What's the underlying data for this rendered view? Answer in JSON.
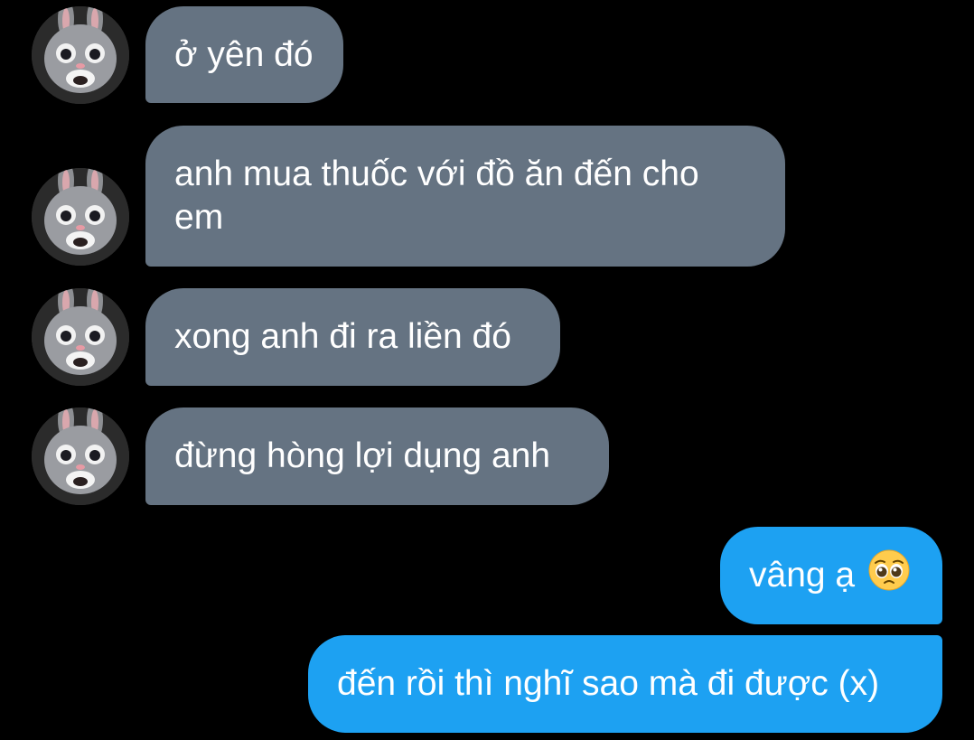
{
  "messages": [
    {
      "side": "incoming",
      "text": "ở yên đó"
    },
    {
      "side": "incoming",
      "text": "anh mua thuốc với đồ ăn đến cho em"
    },
    {
      "side": "incoming",
      "text": "xong anh đi ra liền đó"
    },
    {
      "side": "incoming",
      "text": "đừng hòng lợi dụng anh"
    },
    {
      "side": "outgoing",
      "text": "vâng ạ",
      "emoji": "pleading-face-icon"
    },
    {
      "side": "outgoing",
      "text": "đến rồi thì nghĩ sao mà đi được (x)"
    }
  ],
  "colors": {
    "background": "#000000",
    "incoming_bubble": "#657382",
    "outgoing_bubble": "#1da1f2",
    "text": "#ffffff"
  },
  "avatar": {
    "icon": "bunny-avatar-icon"
  }
}
